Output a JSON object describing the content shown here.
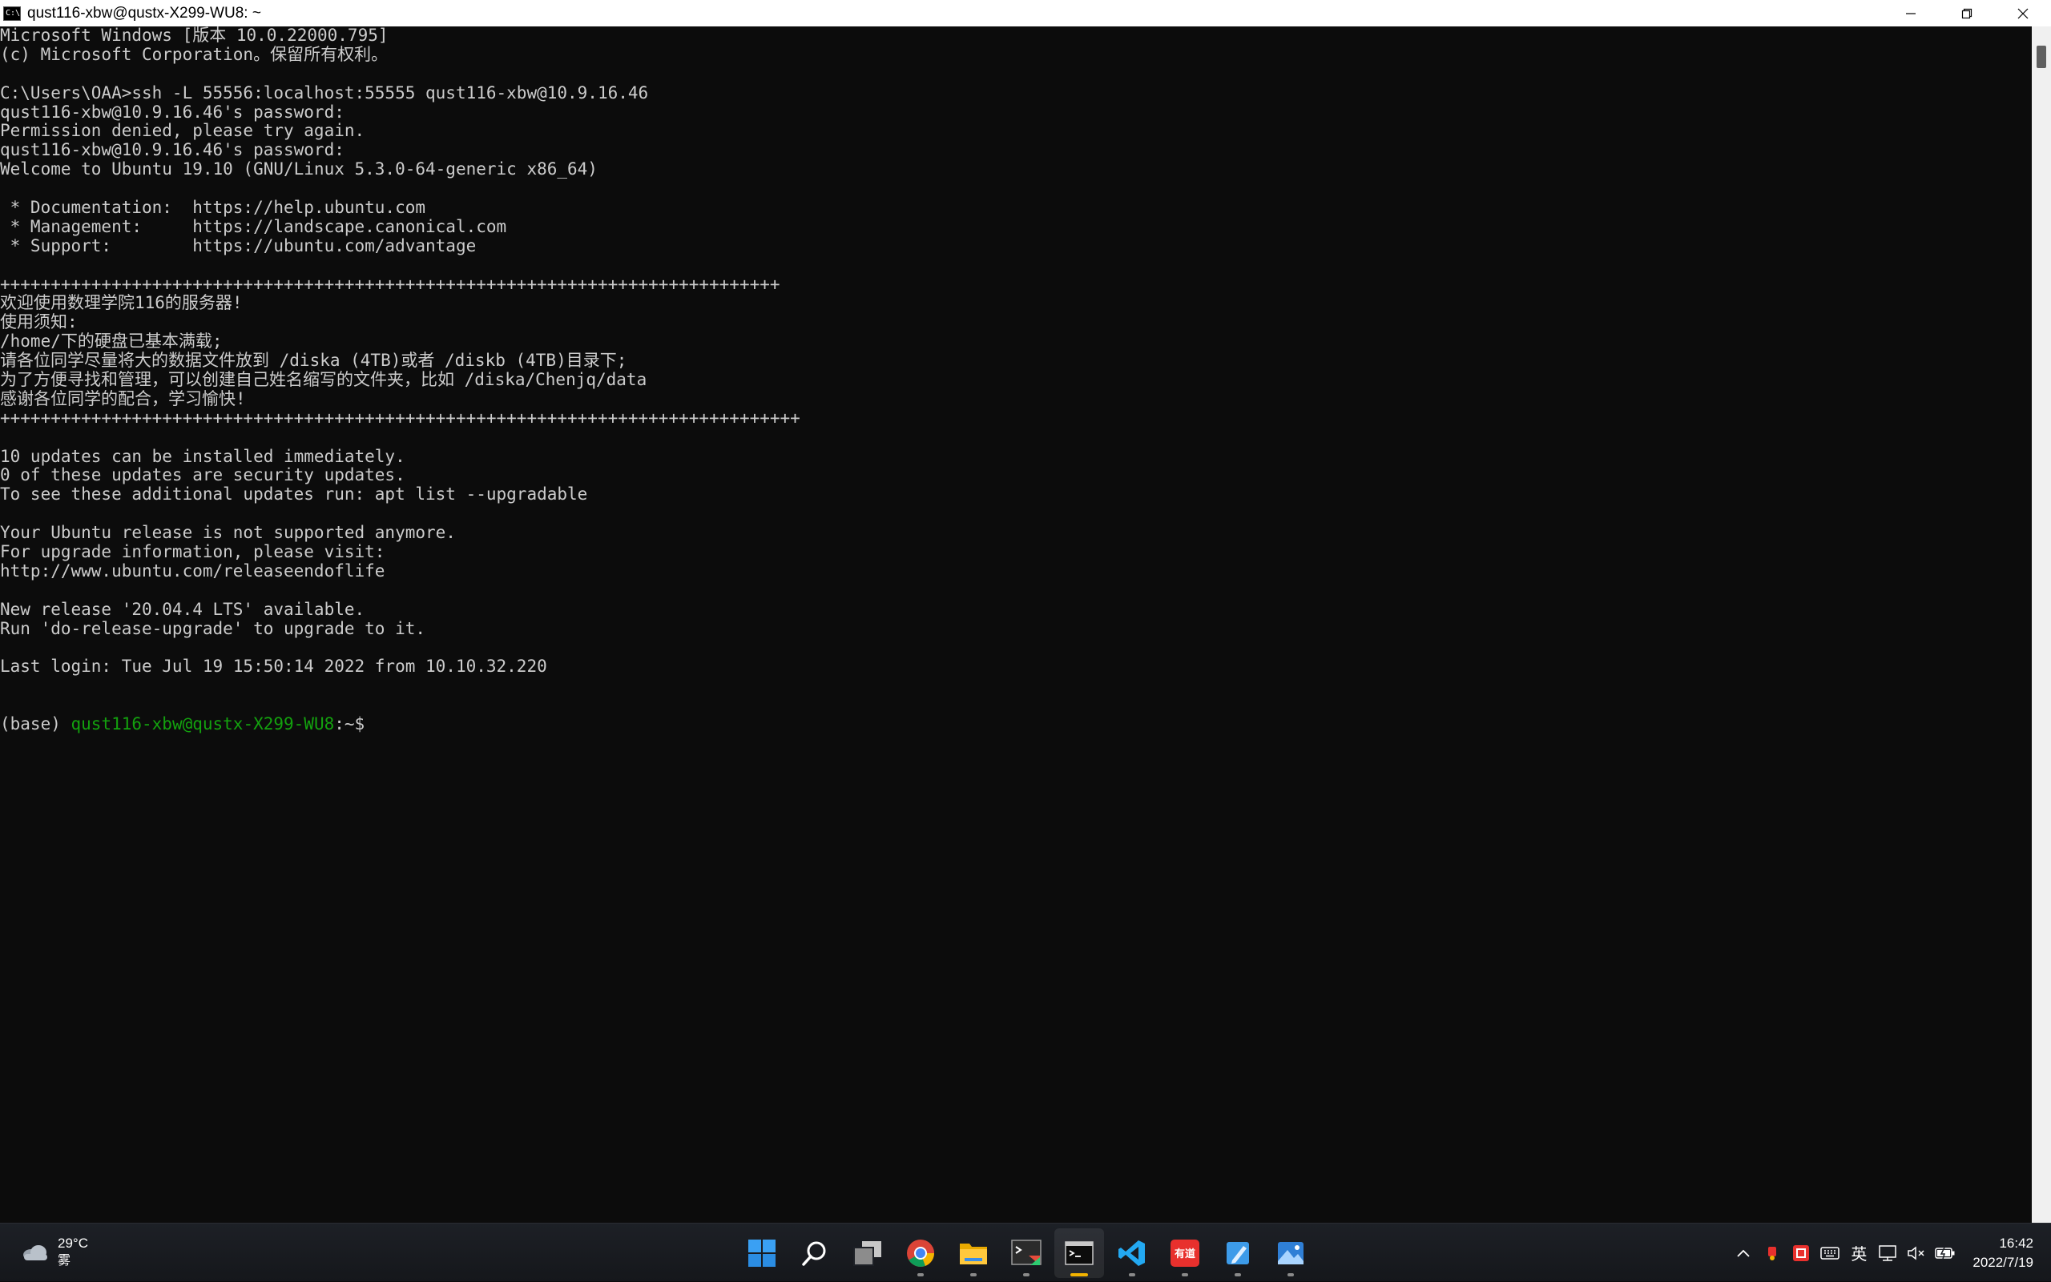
{
  "window": {
    "title": "qust116-xbw@qustx-X299-WU8: ~",
    "app_icon_text": "C:\\"
  },
  "terminal": {
    "lines": [
      "Microsoft Windows [版本 10.0.22000.795]",
      "(c) Microsoft Corporation。保留所有权利。",
      "",
      "C:\\Users\\OAA>ssh -L 55556:localhost:55555 qust116-xbw@10.9.16.46",
      "qust116-xbw@10.9.16.46's password:",
      "Permission denied, please try again.",
      "qust116-xbw@10.9.16.46's password:",
      "Welcome to Ubuntu 19.10 (GNU/Linux 5.3.0-64-generic x86_64)",
      "",
      " * Documentation:  https://help.ubuntu.com",
      " * Management:     https://landscape.canonical.com",
      " * Support:        https://ubuntu.com/advantage",
      "",
      "+++++++++++++++++++++++++++++++++++++++++++++++++++++++++++++++++++++++++++++",
      "欢迎使用数理学院116的服务器!",
      "使用须知:",
      "/home/下的硬盘已基本满载;",
      "请各位同学尽量将大的数据文件放到 /diska (4TB)或者 /diskb (4TB)目录下;",
      "为了方便寻找和管理，可以创建自己姓名缩写的文件夹，比如 /diska/Chenjq/data",
      "感谢各位同学的配合，学习愉快!",
      "+++++++++++++++++++++++++++++++++++++++++++++++++++++++++++++++++++++++++++++++",
      "",
      "10 updates can be installed immediately.",
      "0 of these updates are security updates.",
      "To see these additional updates run: apt list --upgradable",
      "",
      "Your Ubuntu release is not supported anymore.",
      "For upgrade information, please visit:",
      "http://www.ubuntu.com/releaseendoflife",
      "",
      "New release '20.04.4 LTS' available.",
      "Run 'do-release-upgrade' to upgrade to it.",
      "",
      "Last login: Tue Jul 19 15:50:14 2022 from 10.10.32.220"
    ],
    "prompt": {
      "env": "(base) ",
      "user_host": "qust116-xbw@qustx-X299-WU8",
      "path": ":~$"
    }
  },
  "taskbar": {
    "weather": {
      "temperature": "29°C",
      "condition": "雾"
    },
    "apps": [
      {
        "name": "start-icon",
        "active": false
      },
      {
        "name": "search-icon",
        "active": false
      },
      {
        "name": "task-view-icon",
        "active": false
      },
      {
        "name": "chrome-icon",
        "active": false
      },
      {
        "name": "file-explorer-icon",
        "active": false
      },
      {
        "name": "terminal-app-icon",
        "active": false
      },
      {
        "name": "cmd-icon",
        "active": true
      },
      {
        "name": "vscode-icon",
        "active": false
      },
      {
        "name": "youdao-icon",
        "active": false
      },
      {
        "name": "notepad-icon",
        "active": false
      },
      {
        "name": "photos-icon",
        "active": false
      }
    ],
    "youdao_label": "有道",
    "tray": {
      "ime_label": "英"
    },
    "clock": {
      "time": "16:42",
      "date": "2022/7/19"
    }
  },
  "colors": {
    "terminal_bg": "#0c0c0c",
    "terminal_fg": "#cccccc",
    "prompt_green": "#13a10e",
    "taskbar_bg": "#1d2026",
    "accent": "#f2b300"
  }
}
